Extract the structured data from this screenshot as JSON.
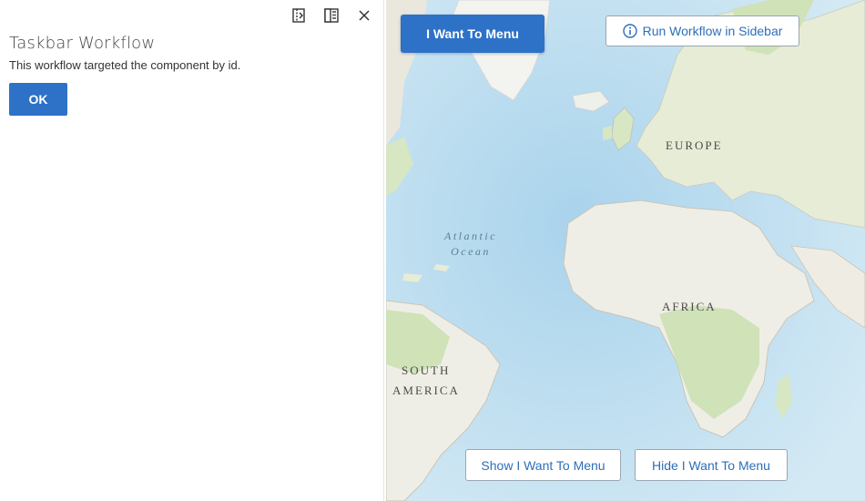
{
  "panel": {
    "title": "Taskbar Workflow",
    "message": "This workflow targeted the component by id.",
    "ok_label": "OK",
    "tools": [
      "dock-left-icon",
      "dock-right-icon",
      "close-icon"
    ]
  },
  "map": {
    "labels": {
      "europe": "EUROPE",
      "africa": "AFRICA",
      "south": "SOUTH",
      "america": "AMERICA",
      "atlantic": "Atlantic",
      "ocean": "Ocean"
    },
    "buttons": {
      "i_want_to_menu": "I Want To Menu",
      "run_workflow": "Run Workflow in Sidebar",
      "show_menu": "Show I Want To Menu",
      "hide_menu": "Hide I Want To Menu"
    }
  },
  "colors": {
    "accent": "#2d72c7",
    "ocean": "#cfe6f3",
    "land": "#efeee6",
    "vegetation": "#cfe2b8"
  }
}
